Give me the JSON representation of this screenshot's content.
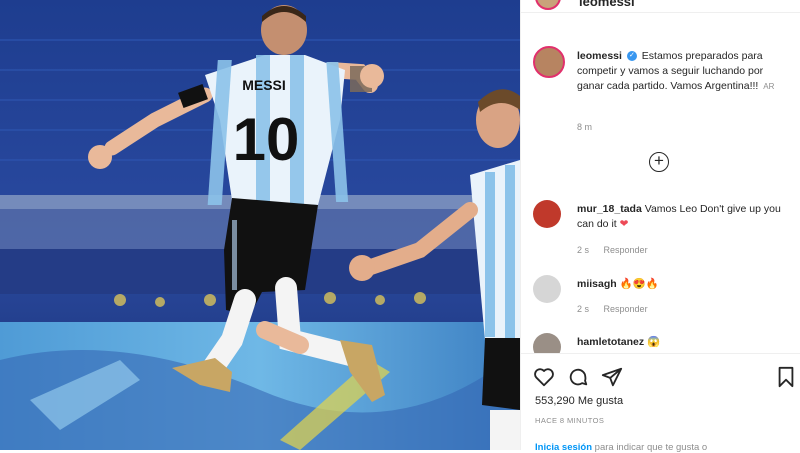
{
  "header": {
    "username": "leomessi"
  },
  "post": {
    "username": "leomessi",
    "caption": "Estamos preparados para competir y vamos a seguir luchando por ganar cada partido. Vamos Argentina!!!",
    "translate_tag": "AR",
    "time": "8 m"
  },
  "photo": {
    "jersey_name": "MESSI",
    "jersey_number": "10"
  },
  "comments": [
    {
      "username": "mur_18_tada",
      "text": "Vamos Leo Don't give up you can do it",
      "emoji": "❤",
      "time": "2 s",
      "reply_label": "Responder"
    },
    {
      "username": "miisagh",
      "text": "",
      "emoji": "🔥😍🔥",
      "time": "2 s",
      "reply_label": "Responder"
    },
    {
      "username": "hamletotanez",
      "text": "",
      "emoji": "😱"
    }
  ],
  "actions": {
    "likes": "553,290 Me gusta",
    "posted_ago": "Hace 8 minutos",
    "login_link": "Inicia sesión",
    "login_text": "para indicar que te gusta o"
  },
  "icons": [
    "verified-badge-icon",
    "add-comment-icon",
    "heart-icon",
    "comment-icon",
    "share-icon",
    "bookmark-icon"
  ],
  "colors": {
    "link_blue": "#0095f6",
    "verified_blue": "#3897f0",
    "like_red": "#ed4956"
  }
}
